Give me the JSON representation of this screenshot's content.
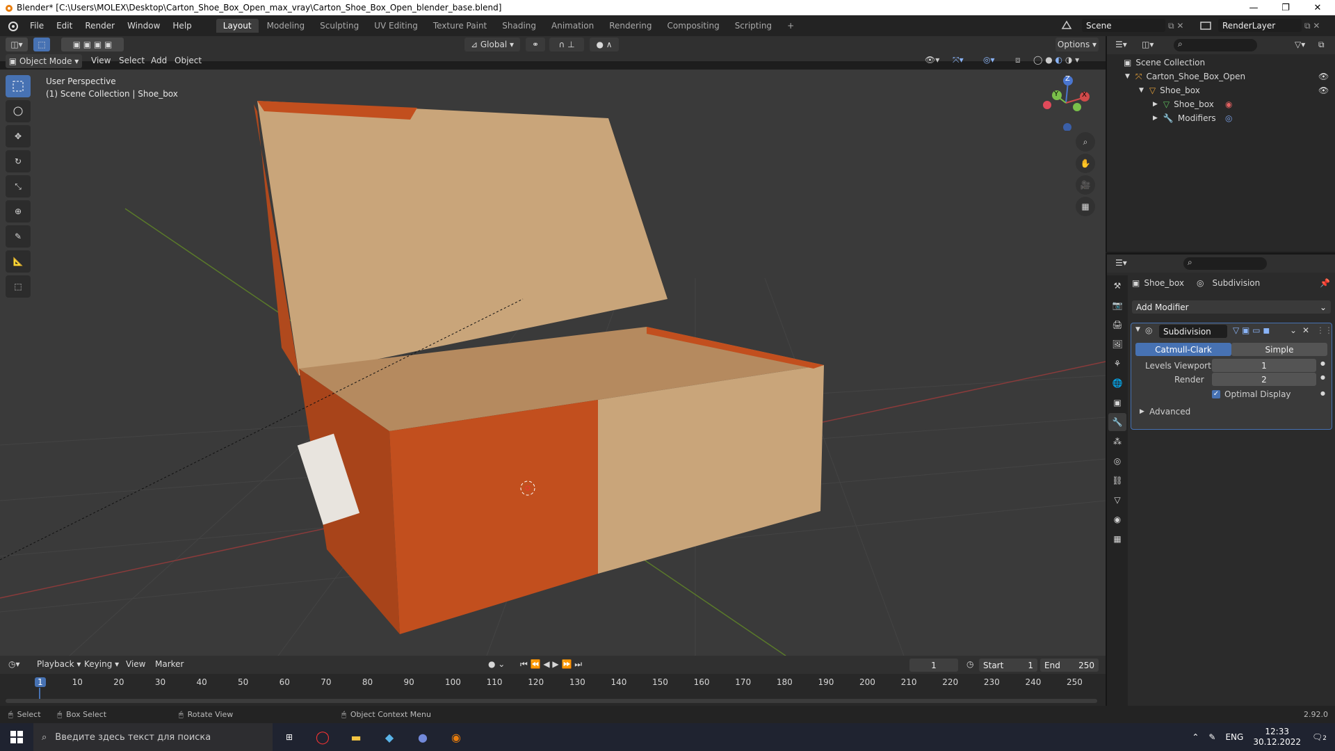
{
  "window": {
    "title": "Blender* [C:\\Users\\MOLEX\\Desktop\\Carton_Shoe_Box_Open_max_vray\\Carton_Shoe_Box_Open_blender_base.blend]"
  },
  "menus": [
    "File",
    "Edit",
    "Render",
    "Window",
    "Help"
  ],
  "workspaces": [
    "Layout",
    "Modeling",
    "Sculpting",
    "UV Editing",
    "Texture Paint",
    "Shading",
    "Animation",
    "Rendering",
    "Compositing",
    "Scripting"
  ],
  "scene": {
    "name": "Scene",
    "view_layer": "RenderLayer"
  },
  "viewport_header": {
    "transform": "Global",
    "options": "Options"
  },
  "viewport_header2": {
    "mode": "Object Mode",
    "items": [
      "View",
      "Select",
      "Add",
      "Object"
    ]
  },
  "viewport": {
    "perspective": "User Perspective",
    "collection_info": "(1) Scene Collection | Shoe_box"
  },
  "gizmo": {
    "z": "Z",
    "y": "Y",
    "x": "X"
  },
  "outliner": {
    "root": "Scene Collection",
    "items": [
      {
        "label": "Carton_Shoe_Box_Open"
      },
      {
        "label": "Shoe_box"
      },
      {
        "label": "Shoe_box"
      },
      {
        "label": "Modifiers"
      }
    ]
  },
  "properties": {
    "object": "Shoe_box",
    "modifier_context": "Subdivision",
    "add_modifier": "Add Modifier",
    "modifier_name": "Subdivision",
    "method_a": "Catmull-Clark",
    "method_b": "Simple",
    "levels_viewport_label": "Levels Viewport",
    "levels_viewport": "1",
    "render_label": "Render",
    "render": "2",
    "optimal_display": "Optimal Display",
    "advanced": "Advanced"
  },
  "timeline": {
    "menus": [
      "Playback",
      "Keying",
      "View",
      "Marker"
    ],
    "current_frame": "1",
    "start_label": "Start",
    "start": "1",
    "end_label": "End",
    "end": "250",
    "ticks": [
      "1",
      "10",
      "20",
      "30",
      "40",
      "50",
      "60",
      "70",
      "80",
      "90",
      "100",
      "110",
      "120",
      "130",
      "140",
      "150",
      "160",
      "170",
      "180",
      "190",
      "200",
      "210",
      "220",
      "230",
      "240",
      "250"
    ]
  },
  "statusbar": {
    "select": "Select",
    "box_select": "Box Select",
    "rotate_view": "Rotate View",
    "context_menu": "Object Context Menu",
    "version": "2.92.0"
  },
  "taskbar": {
    "search": "Введите здесь текст для поиска",
    "lang": "ENG",
    "time": "12:33",
    "date": "30.12.2022",
    "notifications": "2"
  }
}
